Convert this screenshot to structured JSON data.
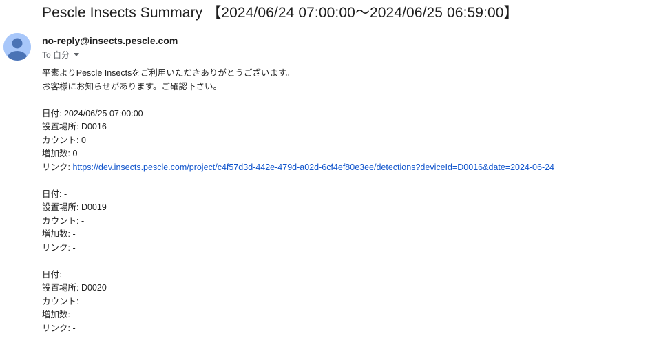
{
  "subject": "Pescle Insects Summary 【2024/06/24 07:00:00～2024/06/25 06:59:00】",
  "sender": "no-reply@insects.pescle.com",
  "recipient_label": "To 自分",
  "greeting": [
    "平素よりPescle Insectsをご利用いただきありがとうございます。",
    "お客様にお知らせがあります。ご確認下さい。"
  ],
  "entries": [
    {
      "date": "日付: 2024/06/25 07:00:00",
      "location": "設置場所: D0016",
      "count": "カウント: 0",
      "increase": "増加数: 0",
      "link_label": "リンク: ",
      "link_url": "https://dev.insects.pescle.com/project/c4f57d3d-442e-479d-a02d-6cf4ef80e3ee/detections?deviceId=D0016&date=2024-06-24"
    },
    {
      "date": "日付: -",
      "location": "設置場所: D0019",
      "count": "カウント: -",
      "increase": "増加数: -",
      "link_label": "リンク: -",
      "link_url": ""
    },
    {
      "date": "日付: -",
      "location": "設置場所: D0020",
      "count": "カウント: -",
      "increase": "増加数: -",
      "link_label": "リンク: -",
      "link_url": ""
    }
  ],
  "colors": {
    "avatar_bg": "#a8c7fa",
    "avatar_fg": "#4b73b5",
    "link": "#1155cc"
  },
  "icons": {
    "avatar": "person-icon",
    "recipient_toggle": "caret-down-icon"
  }
}
